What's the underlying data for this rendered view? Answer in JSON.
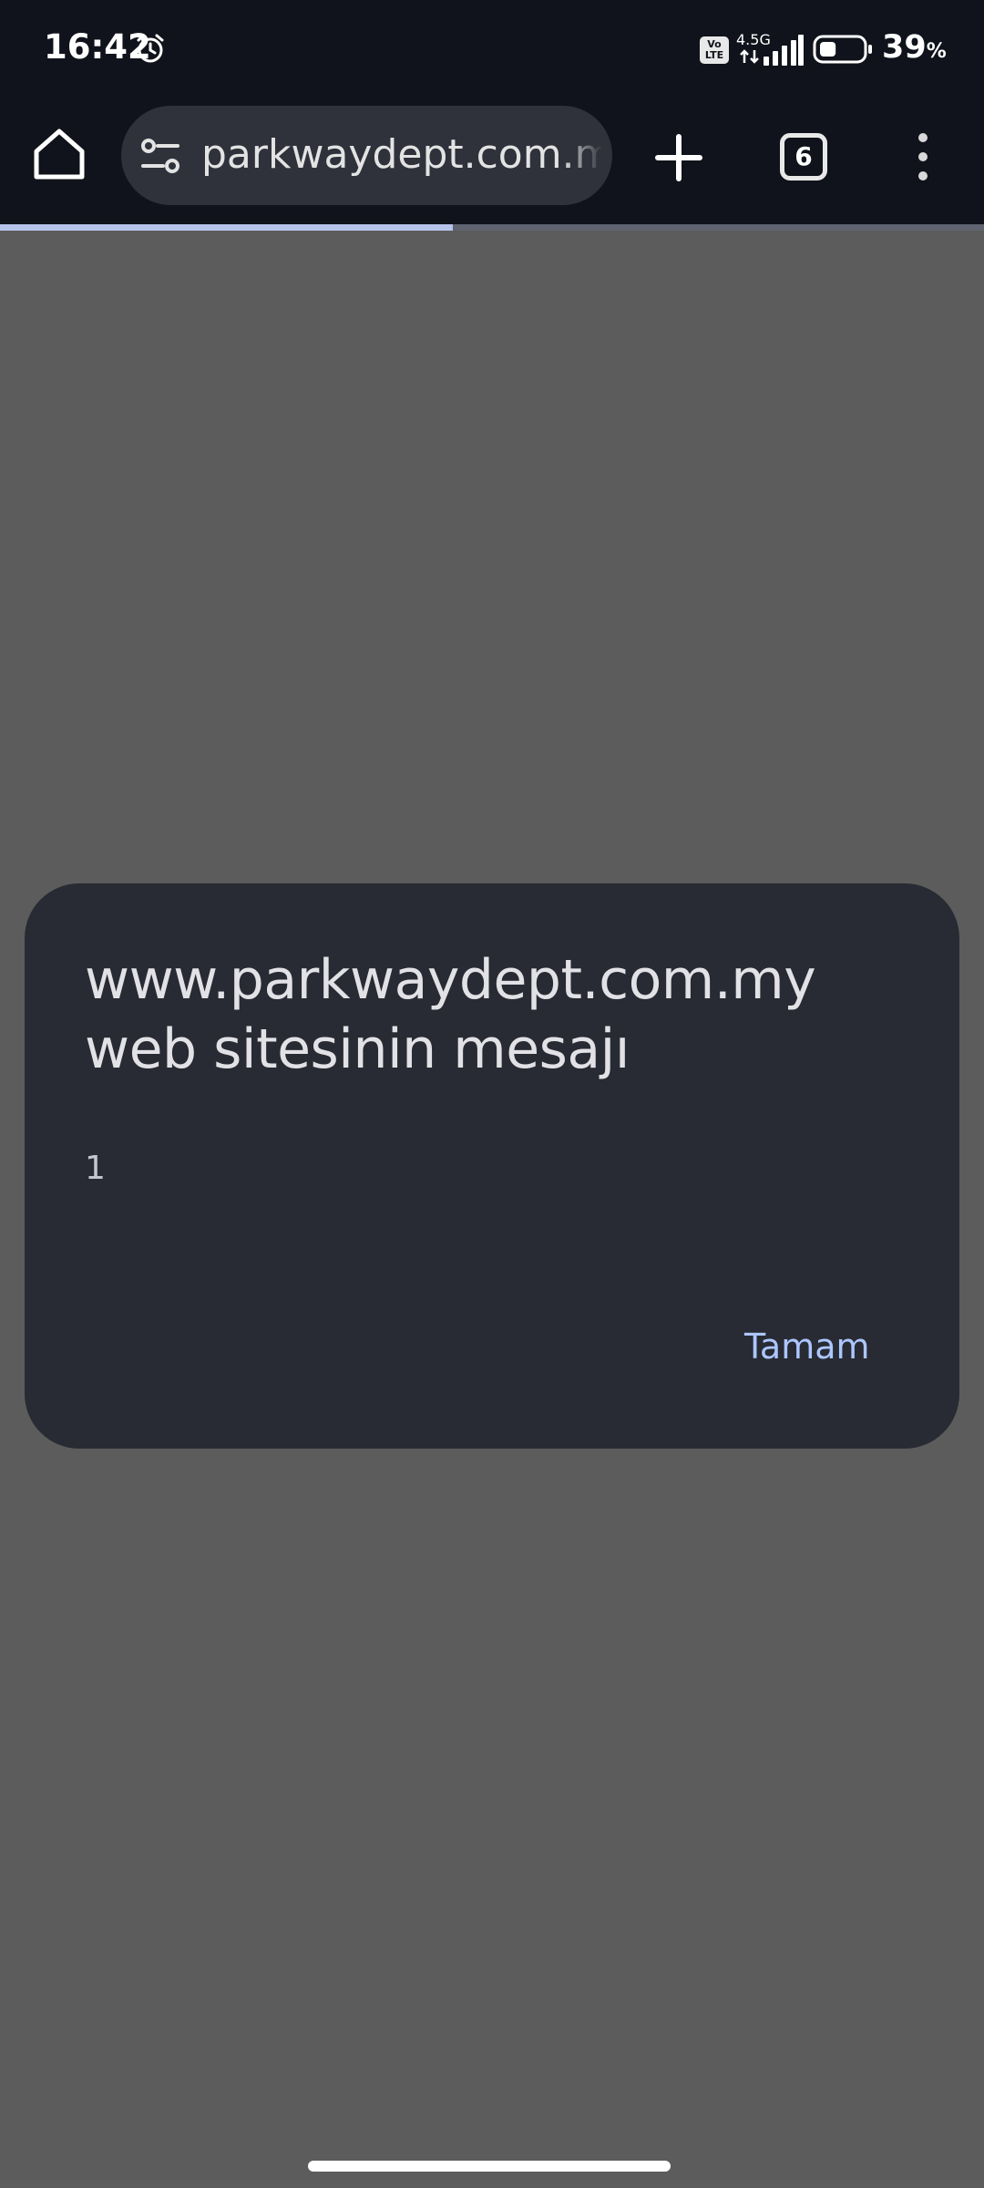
{
  "status_bar": {
    "time": "16:42",
    "network_type": "4.5G",
    "volte_label": "Vo LTE",
    "battery_percent": "39",
    "battery_percent_sign": "%",
    "battery_level": 0.39
  },
  "browser": {
    "url": "parkwaydept.com.my/",
    "tab_count": "6",
    "load_progress": 0.46
  },
  "dialog": {
    "title": "www.parkwaydept.com.my web sitesinin mesajı",
    "message": "1",
    "ok_label": "Tamam"
  },
  "colors": {
    "page_bg": "#5c5c5c",
    "toolbar_bg": "#10131b",
    "dialog_bg": "#282b33",
    "accent": "#adc6ff"
  }
}
